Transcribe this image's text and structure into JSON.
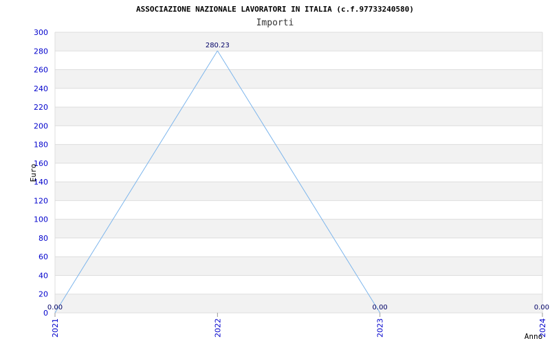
{
  "chart_data": {
    "type": "line",
    "title": "ASSOCIAZIONE NAZIONALE LAVORATORI IN ITALIA (c.f.97733240580)",
    "subtitle": "Importi",
    "xlabel": "Anno",
    "ylabel": "Euro",
    "categories": [
      "2021",
      "2022",
      "2023",
      "2024"
    ],
    "values": [
      0,
      280.23,
      0,
      0
    ],
    "data_labels": [
      "0.00",
      "280.23",
      "0.00",
      "0.00"
    ],
    "ylim": [
      0,
      300
    ],
    "yticks": [
      0,
      20,
      40,
      60,
      80,
      100,
      120,
      140,
      160,
      180,
      200,
      220,
      240,
      260,
      280,
      300
    ],
    "grid": "horizontal alternating bands",
    "colors": {
      "line": "#7cb5ec",
      "band": "#f2f2f2",
      "grid": "#dddddd",
      "tick_text": "#0000cc",
      "data_label": "#000066"
    }
  }
}
